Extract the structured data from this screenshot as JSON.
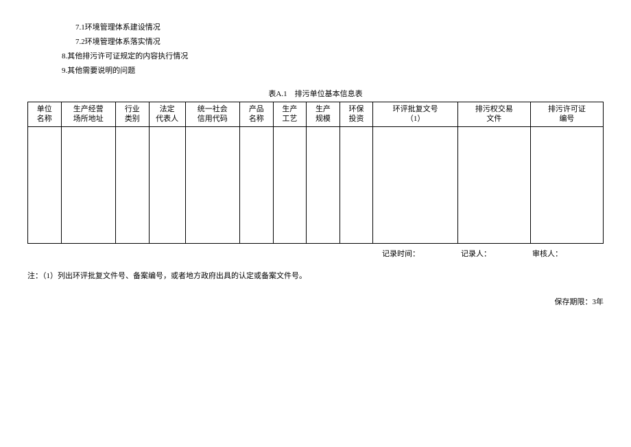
{
  "outline": {
    "item_7_1": "7.1环境管理体系建设情况",
    "item_7_2": "7.2环境管理体系落实情况",
    "item_8": "8.其他排污许可证规定的内容执行情况",
    "item_9": "9.其他需要说明的问题"
  },
  "table": {
    "title": "表A.1　排污单位基本信息表",
    "headers": [
      "单位\n名称",
      "生产经营\n场所地址",
      "行业\n类别",
      "法定\n代表人",
      "统一社会\n信用代码",
      "产品\n名称",
      "生产\n工艺",
      "生产\n规模",
      "环保\n投资",
      "环评批复文号\n（1）",
      "排污权交易\n文件",
      "排污许可证\n编号"
    ]
  },
  "footer": {
    "record_time_label": "记录时间：",
    "recorder_label": "记录人：",
    "auditor_label": "审核人："
  },
  "note": "注：（1）列出环评批复文件号、备案编号，或者地方政府出具的认定或备案文件号。",
  "retention": "保存期限：3年"
}
